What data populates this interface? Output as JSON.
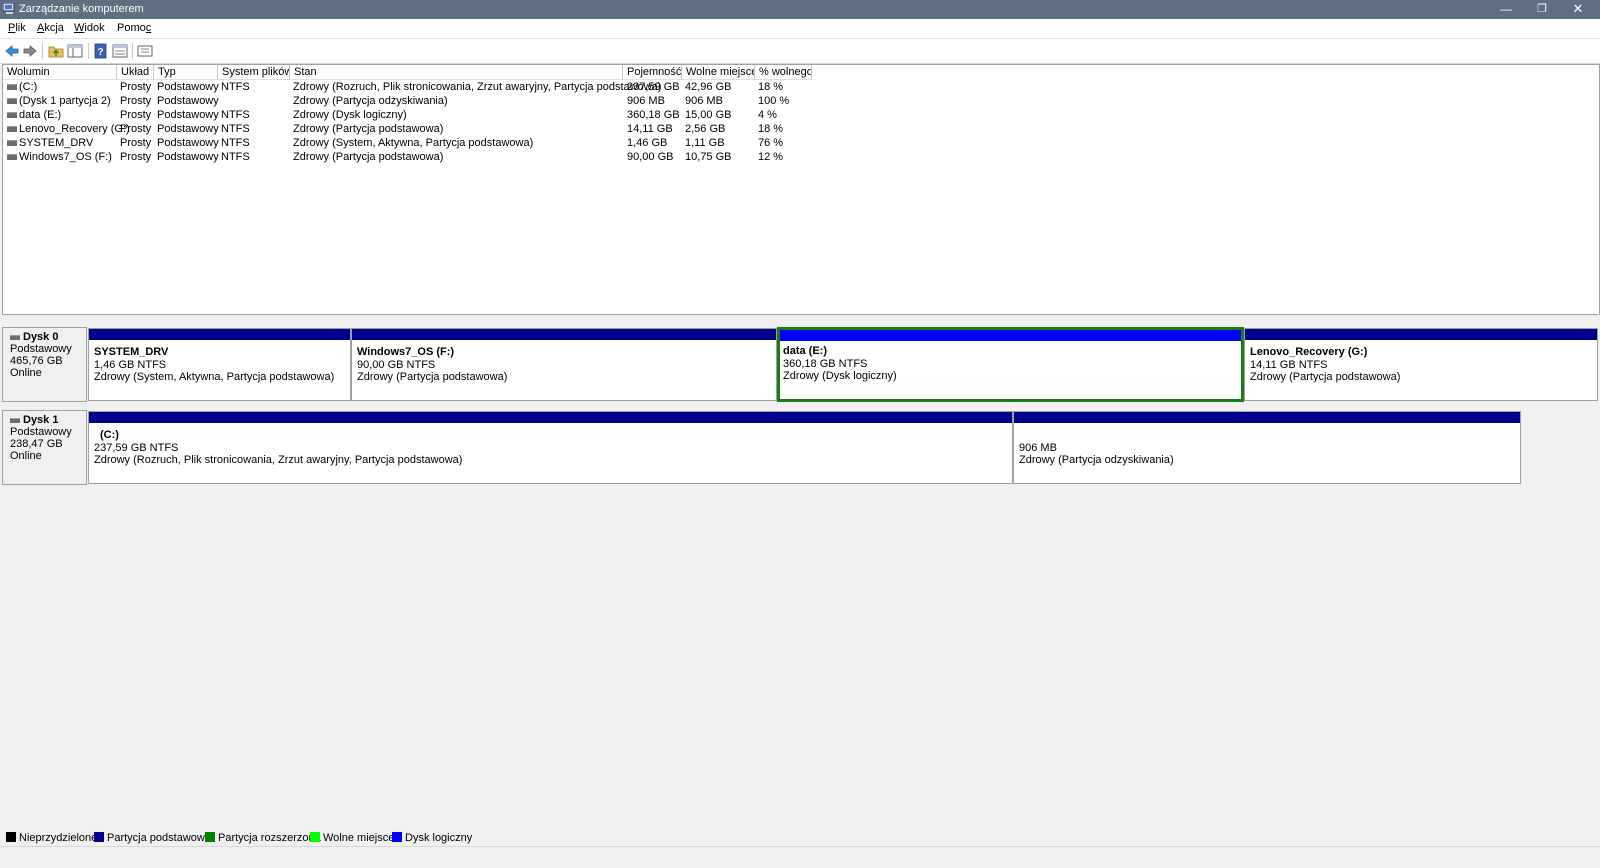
{
  "window": {
    "title": "Zarządzanie komputerem"
  },
  "menu": {
    "items": [
      {
        "label": "Plik",
        "accel": "P",
        "rest": "lik"
      },
      {
        "label": "Akcja",
        "accel": "A",
        "rest": "kcja"
      },
      {
        "label": "Widok",
        "accel": "W",
        "rest": "idok"
      },
      {
        "label": "Pomoc",
        "accel": "c",
        "rest": "Pomo"
      }
    ]
  },
  "toolbar": {
    "icons": [
      "back-arrow-icon",
      "forward-arrow-icon",
      "up-folder-icon",
      "show-hide-tree-icon",
      "help-icon",
      "properties-icon",
      "view-icon"
    ]
  },
  "volume_table": {
    "columns": [
      "Wolumin",
      "Układ",
      "Typ",
      "System plików",
      "Stan",
      "Pojemność",
      "Wolne miejsce",
      "% wolnego"
    ],
    "rows": [
      [
        "(C:)",
        "Prosty",
        "Podstawowy",
        "NTFS",
        "Zdrowy (Rozruch, Plik stronicowania, Zrzut awaryjny, Partycja podstawowa)",
        "237,59 GB",
        "42,96 GB",
        "18 %"
      ],
      [
        "(Dysk 1 partycja 2)",
        "Prosty",
        "Podstawowy",
        "",
        "Zdrowy (Partycja odzyskiwania)",
        "906 MB",
        "906 MB",
        "100 %"
      ],
      [
        "data (E:)",
        "Prosty",
        "Podstawowy",
        "NTFS",
        "Zdrowy (Dysk logiczny)",
        "360,18 GB",
        "15,00 GB",
        "4 %"
      ],
      [
        "Lenovo_Recovery (G:)",
        "Prosty",
        "Podstawowy",
        "NTFS",
        "Zdrowy (Partycja podstawowa)",
        "14,11 GB",
        "2,56 GB",
        "18 %"
      ],
      [
        "SYSTEM_DRV",
        "Prosty",
        "Podstawowy",
        "NTFS",
        "Zdrowy (System, Aktywna, Partycja podstawowa)",
        "1,46 GB",
        "1,11 GB",
        "76 %"
      ],
      [
        "Windows7_OS (F:)",
        "Prosty",
        "Podstawowy",
        "NTFS",
        "Zdrowy (Partycja podstawowa)",
        "90,00 GB",
        "10,75 GB",
        "12 %"
      ]
    ]
  },
  "disks": [
    {
      "name": "Dysk 0",
      "type": "Podstawowy",
      "size": "465,76 GB",
      "status": "Online",
      "partitions": [
        {
          "name": "SYSTEM_DRV",
          "size": "1,46 GB NTFS",
          "status": "Zdrowy (System, Aktywna, Partycja podstawowa)",
          "bar_color": "#00008b"
        },
        {
          "name": "Windows7_OS  (F:)",
          "size": "90,00 GB NTFS",
          "status": "Zdrowy (Partycja podstawowa)",
          "bar_color": "#00008b"
        },
        {
          "name": "data  (E:)",
          "size": "360,18 GB NTFS",
          "status": "Zdrowy (Dysk logiczny)",
          "bar_color": "#0000ff"
        },
        {
          "name": "Lenovo_Recovery  (G:)",
          "size": "14,11 GB NTFS",
          "status": "Zdrowy (Partycja podstawowa)",
          "bar_color": "#00008b"
        }
      ]
    },
    {
      "name": "Dysk 1",
      "type": "Podstawowy",
      "size": "238,47 GB",
      "status": "Online",
      "partitions": [
        {
          "name": "(C:)",
          "size": "237,59 GB NTFS",
          "status": "Zdrowy (Rozruch, Plik stronicowania, Zrzut awaryjny, Partycja podstawowa)",
          "bar_color": "#00008b"
        },
        {
          "name": "",
          "size": "906 MB",
          "status": "Zdrowy (Partycja odzyskiwania)",
          "bar_color": "#00008b"
        }
      ]
    }
  ],
  "legend": [
    {
      "label": "Nieprzydzielone",
      "color": "#000000"
    },
    {
      "label": "Partycja podstawowa",
      "color": "#00008b"
    },
    {
      "label": "Partycja rozszerzona",
      "color": "#008000"
    },
    {
      "label": "Wolne miejsce",
      "color": "#00ff00"
    },
    {
      "label": "Dysk logiczny",
      "color": "#0000ff"
    }
  ]
}
